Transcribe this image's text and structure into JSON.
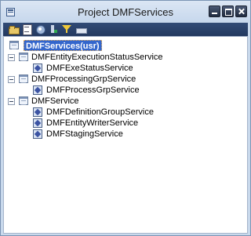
{
  "window": {
    "title": "Project DMFServices"
  },
  "toolbar": {
    "buttons": [
      {
        "icon": "open-folder-icon"
      },
      {
        "icon": "properties-icon"
      },
      {
        "icon": "compile-icon"
      },
      {
        "icon": "run-icon"
      },
      {
        "icon": "filter-icon"
      },
      {
        "icon": "project-group-icon"
      }
    ]
  },
  "tree": {
    "root": {
      "label": "DMFServices(usr)",
      "selected": true
    },
    "groups": [
      {
        "label": "DMFEntityExecutionStatusService",
        "expanded": true,
        "children": [
          {
            "label": "DMFExeStatusService"
          }
        ]
      },
      {
        "label": "DMFProcessingGrpService",
        "expanded": true,
        "children": [
          {
            "label": "DMFProcessGrpService"
          }
        ]
      },
      {
        "label": "DMFService",
        "expanded": true,
        "children": [
          {
            "label": "DMFDefinitionGroupService"
          },
          {
            "label": "DMFEntityWriterService"
          },
          {
            "label": "DMFStagingService"
          }
        ]
      }
    ]
  },
  "colors": {
    "selection": "#3366cc",
    "toolbar": "#2c4470",
    "titlebar": "#cfdeef"
  }
}
